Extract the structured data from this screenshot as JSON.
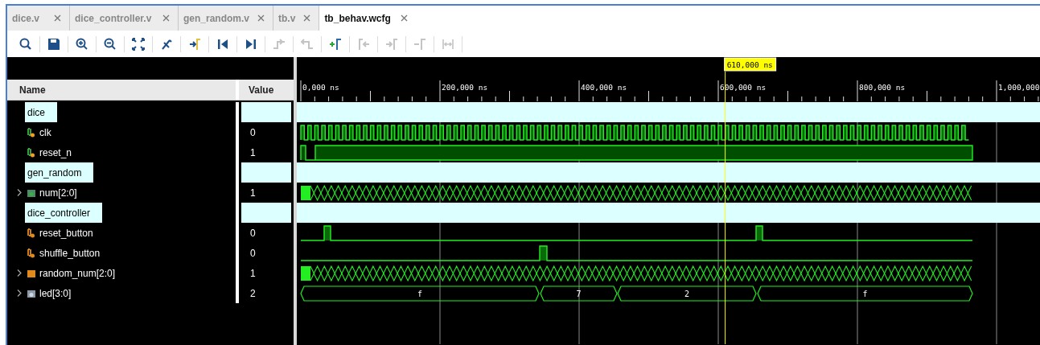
{
  "tabs": [
    {
      "label": "dice.v",
      "selected": false
    },
    {
      "label": "dice_controller.v",
      "selected": false
    },
    {
      "label": "gen_random.v",
      "selected": false
    },
    {
      "label": "tb.v",
      "selected": false
    },
    {
      "label": "tb_behav.wcfg",
      "selected": true
    }
  ],
  "toolbar": [
    {
      "kind": "search",
      "disabled": false
    },
    {
      "kind": "save",
      "disabled": false
    },
    {
      "kind": "zoom_in",
      "disabled": false
    },
    {
      "kind": "zoom_out",
      "disabled": false
    },
    {
      "kind": "zoom_fit",
      "disabled": false
    },
    {
      "kind": "snap",
      "disabled": false
    },
    {
      "kind": "goto_cursor",
      "disabled": false
    },
    {
      "kind": "goto_start",
      "disabled": false
    },
    {
      "kind": "goto_end",
      "disabled": false
    },
    {
      "kind": "prev_transition",
      "disabled": true
    },
    {
      "kind": "next_transition",
      "disabled": true
    },
    {
      "kind": "add_marker",
      "disabled": false
    },
    {
      "kind": "prev_marker",
      "disabled": true
    },
    {
      "kind": "next_marker",
      "disabled": true
    },
    {
      "kind": "delete_marker",
      "disabled": true
    },
    {
      "kind": "swap",
      "disabled": true
    }
  ],
  "columns": {
    "name": "Name",
    "value": "Value"
  },
  "cursor": {
    "label": "610,000 ns"
  },
  "ruler": [
    "0,000 ns",
    "200,000 ns",
    "400,000 ns",
    "600,000 ns",
    "800,000 ns",
    "1,000,000"
  ],
  "rows": [
    {
      "kind": "group",
      "name": "dice"
    },
    {
      "kind": "clock",
      "name": "clk",
      "value": "0"
    },
    {
      "kind": "reset",
      "name": "reset_n",
      "value": "1"
    },
    {
      "kind": "group",
      "name": "gen_random"
    },
    {
      "kind": "bus",
      "name": "num[2:0]",
      "value": "1",
      "expanded": false
    },
    {
      "kind": "group",
      "name": "dice_controller"
    },
    {
      "kind": "pulse",
      "name": "reset_button",
      "value": "0"
    },
    {
      "kind": "pulse",
      "name": "shuffle_button",
      "value": "0"
    },
    {
      "kind": "bus",
      "name": "random_num[2:0]",
      "value": "1",
      "expanded": false
    },
    {
      "kind": "bus_values",
      "name": "led[3:0]",
      "value": "2",
      "expanded": false,
      "segments": [
        "f",
        "7",
        "2",
        "f"
      ]
    }
  ]
}
